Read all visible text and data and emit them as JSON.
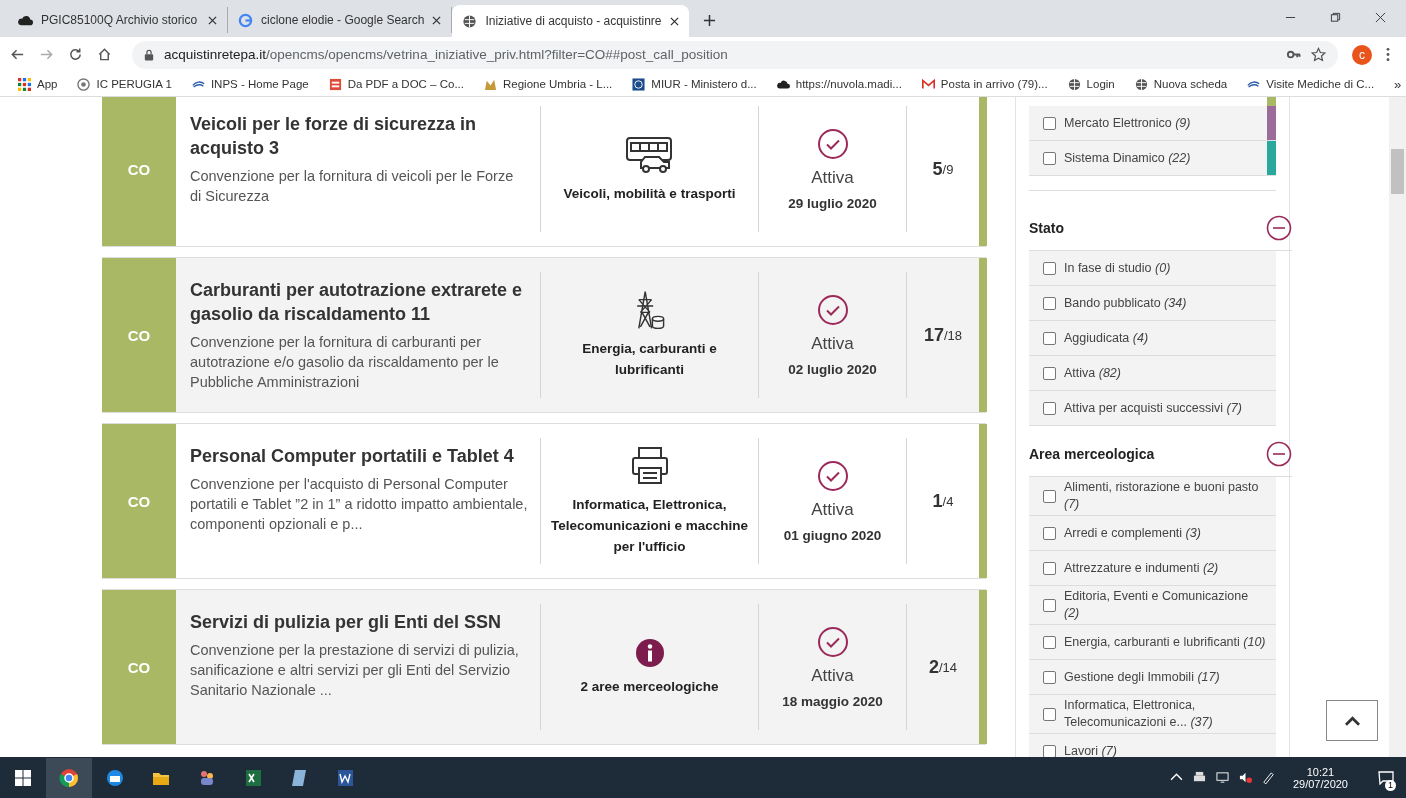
{
  "browser": {
    "tabs": [
      {
        "title": "PGIC85100Q Archivio storico",
        "kind": "cloud",
        "selected": false
      },
      {
        "title": "ciclone elodie - Google Search",
        "kind": "google",
        "selected": false
      },
      {
        "title": "Iniziative di acquisto - acquistinre",
        "kind": "globe",
        "selected": true
      }
    ],
    "url_host": "acquistinretepa.it",
    "url_path": "/opencms/opencms/vetrina_iniziative_priv.html?filter=CO##post_call_position",
    "profile_initial": "c",
    "bookmarks": [
      {
        "label": "App",
        "kind": "apps"
      },
      {
        "label": "IC PERUGIA 1",
        "kind": "seal"
      },
      {
        "label": "INPS - Home Page",
        "kind": "swoosh"
      },
      {
        "label": "Da PDF a DOC – Co...",
        "kind": "pdf"
      },
      {
        "label": "Regione Umbria - L...",
        "kind": "region"
      },
      {
        "label": "MIUR - Ministero d...",
        "kind": "miur"
      },
      {
        "label": "https://nuvola.madi...",
        "kind": "cloud"
      },
      {
        "label": "Posta in arrivo (79)...",
        "kind": "mail"
      },
      {
        "label": "Login",
        "kind": "globe"
      },
      {
        "label": "Nuova scheda",
        "kind": "globe"
      },
      {
        "label": "Visite Mediche di C...",
        "kind": "swoosh"
      }
    ],
    "more": "»"
  },
  "initiatives": [
    {
      "badge": "CO",
      "title": "Veicoli per le forze di sicurezza in acquisto 3",
      "description": "Convenzione per la fornitura di veicoli per le Forze di Sicurezza",
      "category": "Veicoli, mobilità e trasporti",
      "kind": "vehicles",
      "status": "Attiva",
      "date": "29 luglio 2020",
      "count": "5",
      "total": "/9"
    },
    {
      "badge": "CO",
      "title": "Carburanti per autotrazione extrarete e gasolio da riscaldamento 11",
      "description": "Convenzione per la fornitura di carburanti per autotrazione e/o gasolio da riscaldamento per le Pubbliche Amministrazioni",
      "category": "Energia, carburanti e lubrificanti",
      "kind": "energy",
      "status": "Attiva",
      "date": "02 luglio 2020",
      "count": "17",
      "total": "/18"
    },
    {
      "badge": "CO",
      "title": "Personal Computer portatili e Tablet 4",
      "description": "Convenzione per l'acquisto di Personal Computer portatili e Tablet ”2 in 1” a ridotto impatto ambientale, componenti opzionali e p...",
      "category": "Informatica, Elettronica, Telecomunicazioni e macchine per l'ufficio",
      "kind": "printer",
      "status": "Attiva",
      "date": "01 giugno 2020",
      "count": "1",
      "total": "/4"
    },
    {
      "badge": "CO",
      "title": "Servizi di pulizia per gli Enti del SSN",
      "description": "Convenzione per la prestazione di servizi di pulizia, sanificazione e altri servizi per gli Enti del Servizio Sanitario Nazionale ...",
      "category": "2 aree merceologiche",
      "kind": "info",
      "status": "Attiva",
      "date": "18 maggio 2020",
      "count": "2",
      "total": "/14"
    }
  ],
  "filters": {
    "tool_items": [
      {
        "label": "Mercato Elettronico",
        "count": "(9)",
        "checked": false,
        "color": "#9a6b9b"
      },
      {
        "label": "Sistema Dinamico",
        "count": "(22)",
        "checked": false,
        "color": "#2aa89e"
      }
    ],
    "groups": [
      {
        "title": "Stato",
        "expanded": true,
        "items": [
          {
            "label": "In fase di studio",
            "count": "(0)",
            "checked": false
          },
          {
            "label": "Bando pubblicato",
            "count": "(34)",
            "checked": false
          },
          {
            "label": "Aggiudicata",
            "count": "(4)",
            "checked": false
          },
          {
            "label": "Attiva",
            "count": "(82)",
            "checked": false
          },
          {
            "label": "Attiva per acquisti successivi",
            "count": "(7)",
            "checked": false
          }
        ]
      },
      {
        "title": "Area merceologica",
        "expanded": true,
        "items": [
          {
            "label": "Alimenti, ristorazione e buoni pasto",
            "count": "(7)",
            "checked": false
          },
          {
            "label": "Arredi e complementi",
            "count": "(3)",
            "checked": false
          },
          {
            "label": "Attrezzature e indumenti",
            "count": "(2)",
            "checked": false
          },
          {
            "label": "Editoria, Eventi e Comunicazione",
            "count": "(2)",
            "checked": false
          },
          {
            "label": "Energia, carburanti e lubrificanti",
            "count": "(10)",
            "checked": false
          },
          {
            "label": "Gestione degli Immobili",
            "count": "(17)",
            "checked": false
          },
          {
            "label": "Informatica, Elettronica, Telecomunicazioni e...",
            "count": "(37)",
            "checked": false
          },
          {
            "label": "Lavori",
            "count": "(7)",
            "checked": false
          }
        ]
      }
    ]
  },
  "taskbar": {
    "time": "10:21",
    "date": "29/07/2020",
    "notifications": "1"
  }
}
